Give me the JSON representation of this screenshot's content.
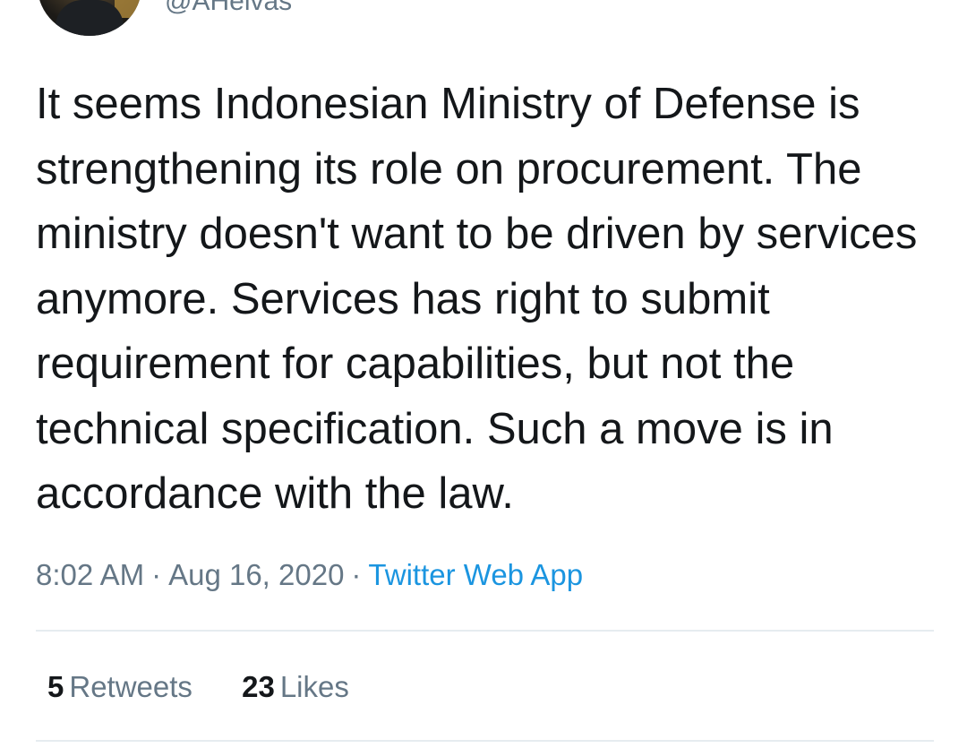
{
  "user": {
    "handle": "@AHelvas"
  },
  "tweet": {
    "text": "It seems Indonesian Ministry of Defense is strengthening its role on procurement. The ministry doesn't want to be driven by services anymore. Services has right to submit requirement for capabilities, but not the technical specification. Such a move is in accordance with the law.",
    "time": "8:02 AM",
    "date": "Aug 16, 2020",
    "separator": "·",
    "source": "Twitter Web App"
  },
  "stats": {
    "retweets_count": "5",
    "retweets_label": "Retweets",
    "likes_count": "23",
    "likes_label": "Likes"
  },
  "colors": {
    "text": "#14171a",
    "muted": "#657786",
    "link": "#1b95e0",
    "divider": "#e6ecf0"
  }
}
